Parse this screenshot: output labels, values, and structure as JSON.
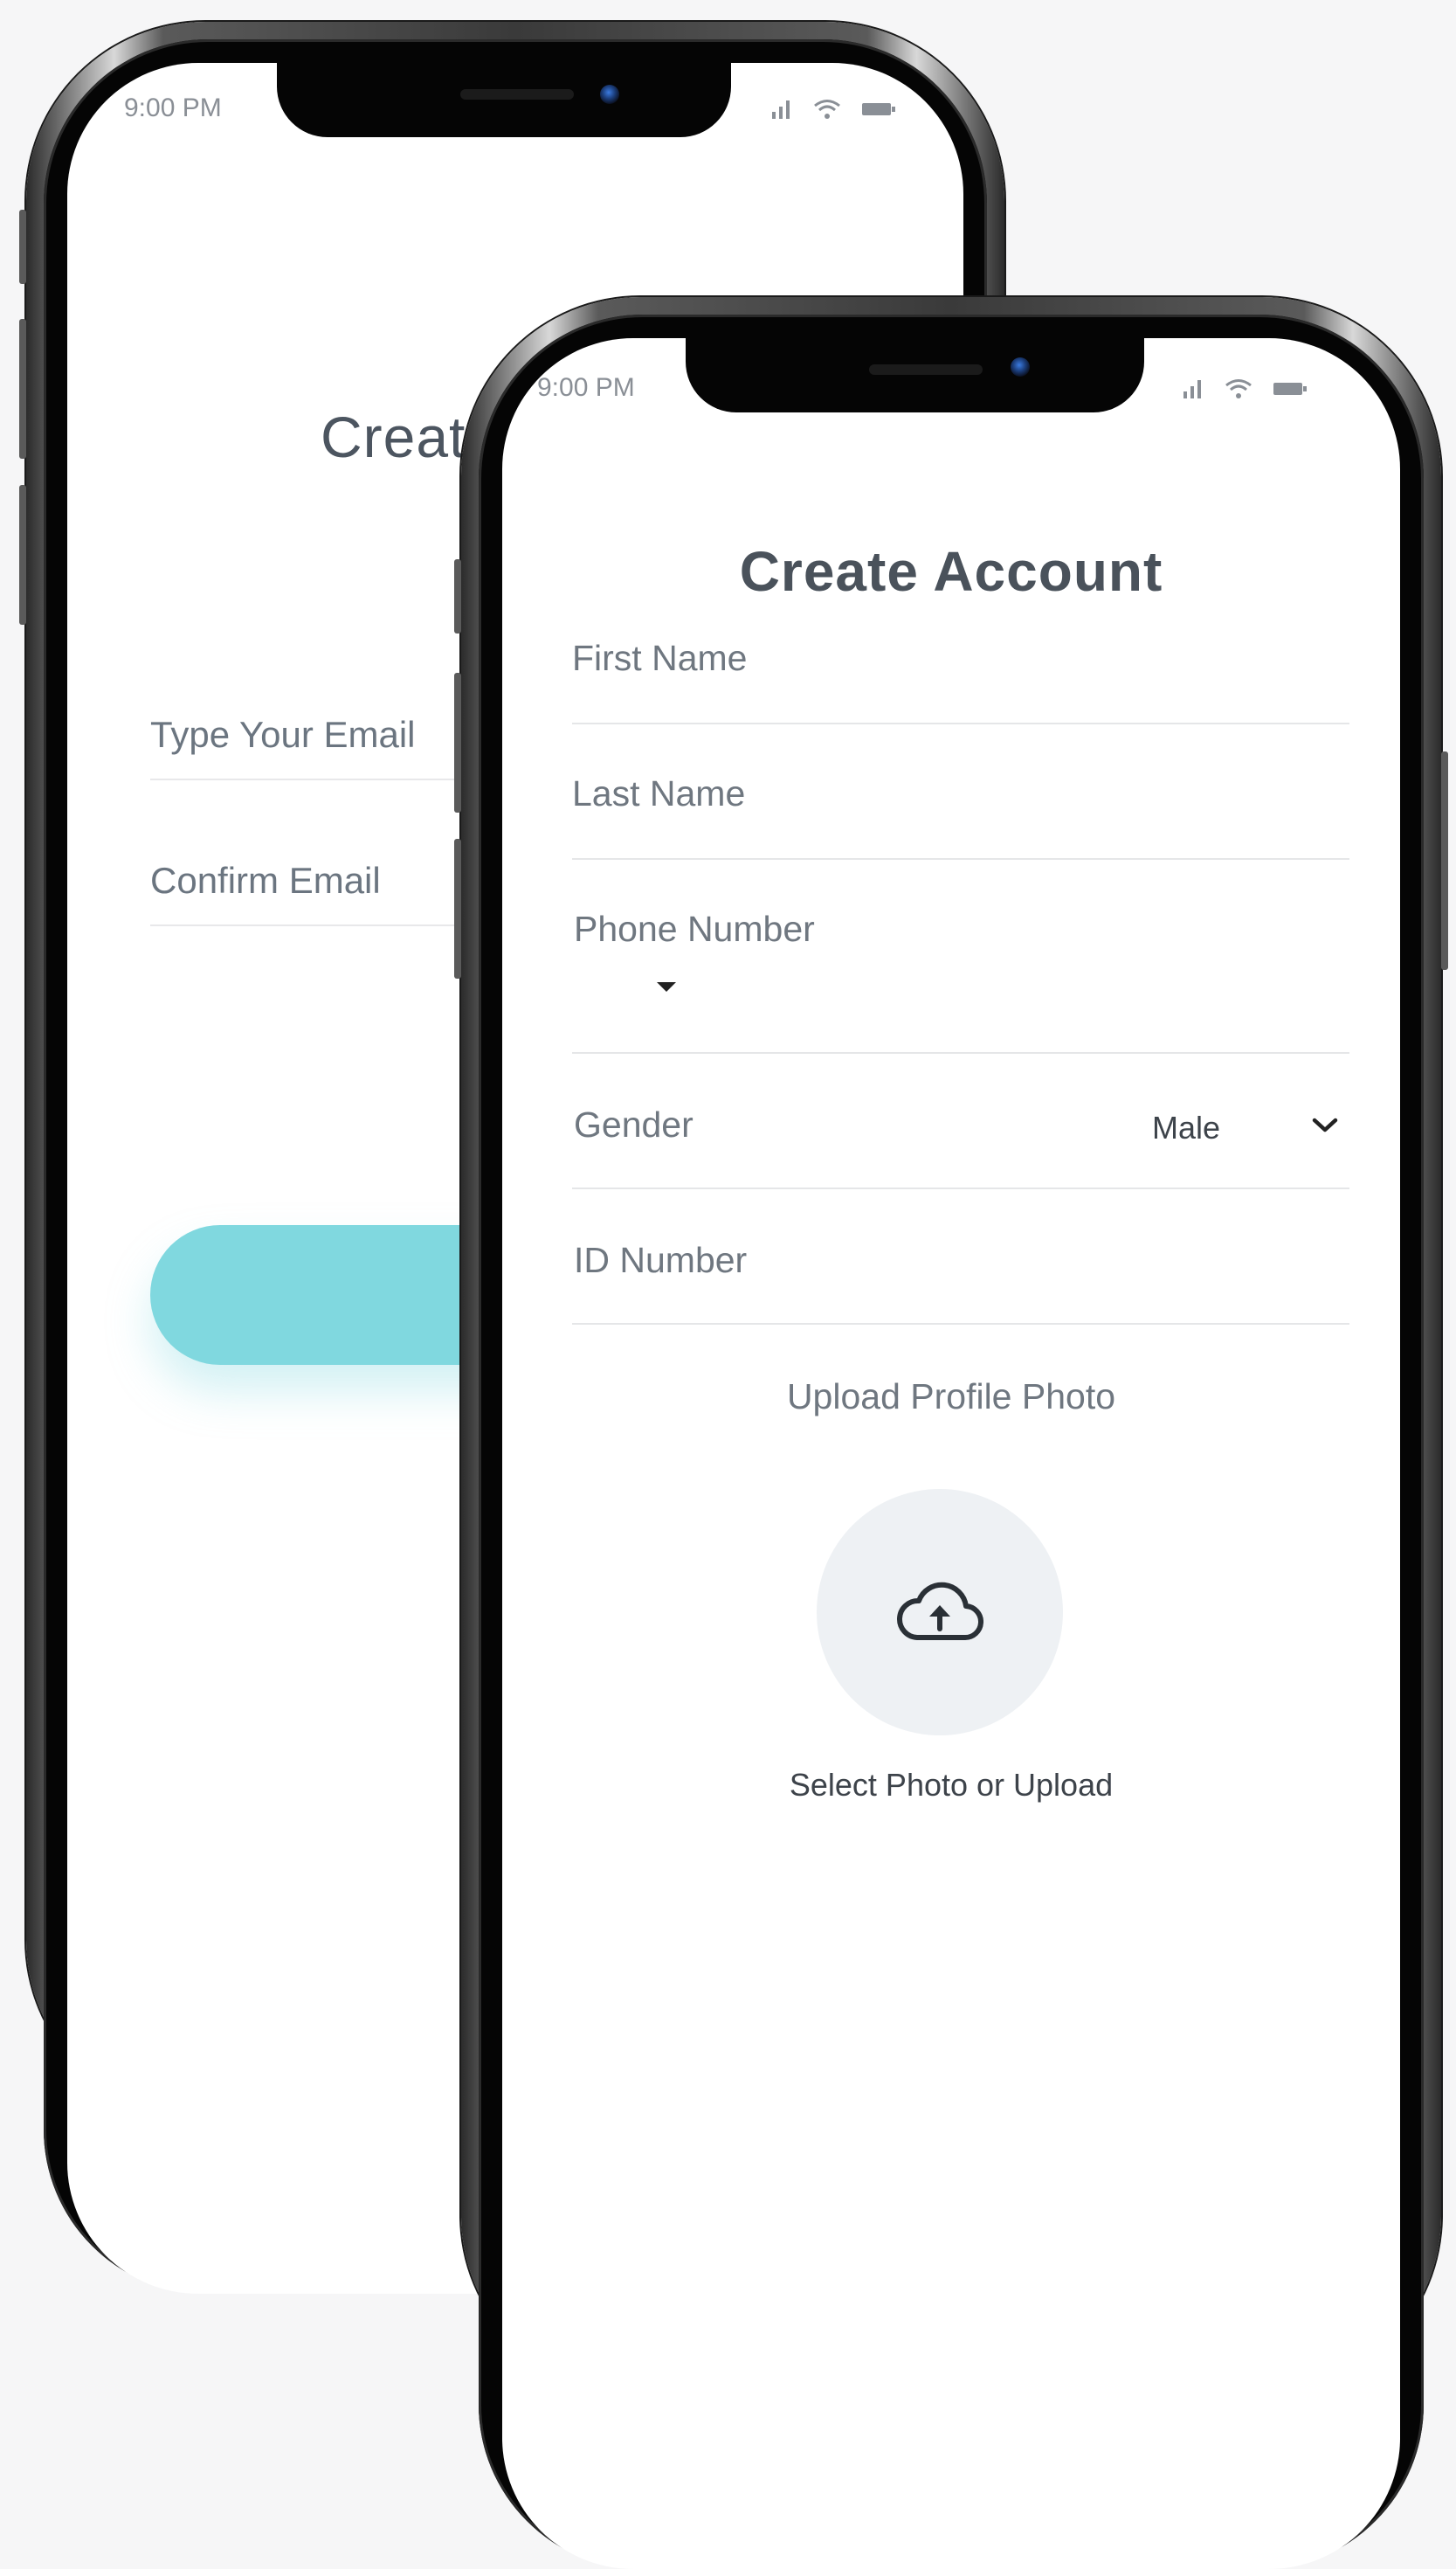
{
  "back_phone": {
    "status_time": "9:00 PM",
    "title": "Create",
    "fields": {
      "email_placeholder": "Type Your Email",
      "confirm_email_placeholder": "Confirm Email"
    },
    "button_color": "#80d8df"
  },
  "front_phone": {
    "status_time": "9:00 PM",
    "title": "Create Account",
    "fields": {
      "first_name": "First Name",
      "last_name": "Last Name",
      "phone_number": "Phone Number",
      "gender_label": "Gender",
      "gender_value": "Male",
      "id_number": "ID Number"
    },
    "upload": {
      "title": "Upload Profile Photo",
      "caption": "Select Photo or Upload",
      "icon": "cloud-upload-icon"
    }
  },
  "colors": {
    "background": "#f6f6f7",
    "accent": "#80d8df",
    "text": "#4a525b"
  }
}
